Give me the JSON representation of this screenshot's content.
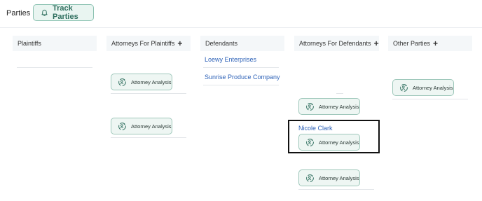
{
  "header": {
    "title": "Parties",
    "track_button_label": "Track Parties"
  },
  "columns": {
    "plaintiffs": {
      "label": "Plaintiffs"
    },
    "attorneys_for_plaintiffs": {
      "label": "Attorneys For Plaintiffs"
    },
    "defendants": {
      "label": "Defendants",
      "items": [
        "Loewy Enterprises",
        "Sunrise Produce Company"
      ]
    },
    "attorneys_for_defendants": {
      "label": "Attorneys For Defendants",
      "attorney_name": "Nicole Clark"
    },
    "other_parties": {
      "label": "Other Parties"
    }
  },
  "attorney_analysis_label": "Attorney Analysis",
  "colors": {
    "accent": "#2e6e5e",
    "pill_bg": "#eef6f3",
    "link": "#2f63b8",
    "header_bg": "#f4f7f9"
  },
  "icons": {
    "track": "bell-icon",
    "analysis": "attorney-analysis-icon",
    "add": "plus-icon"
  }
}
